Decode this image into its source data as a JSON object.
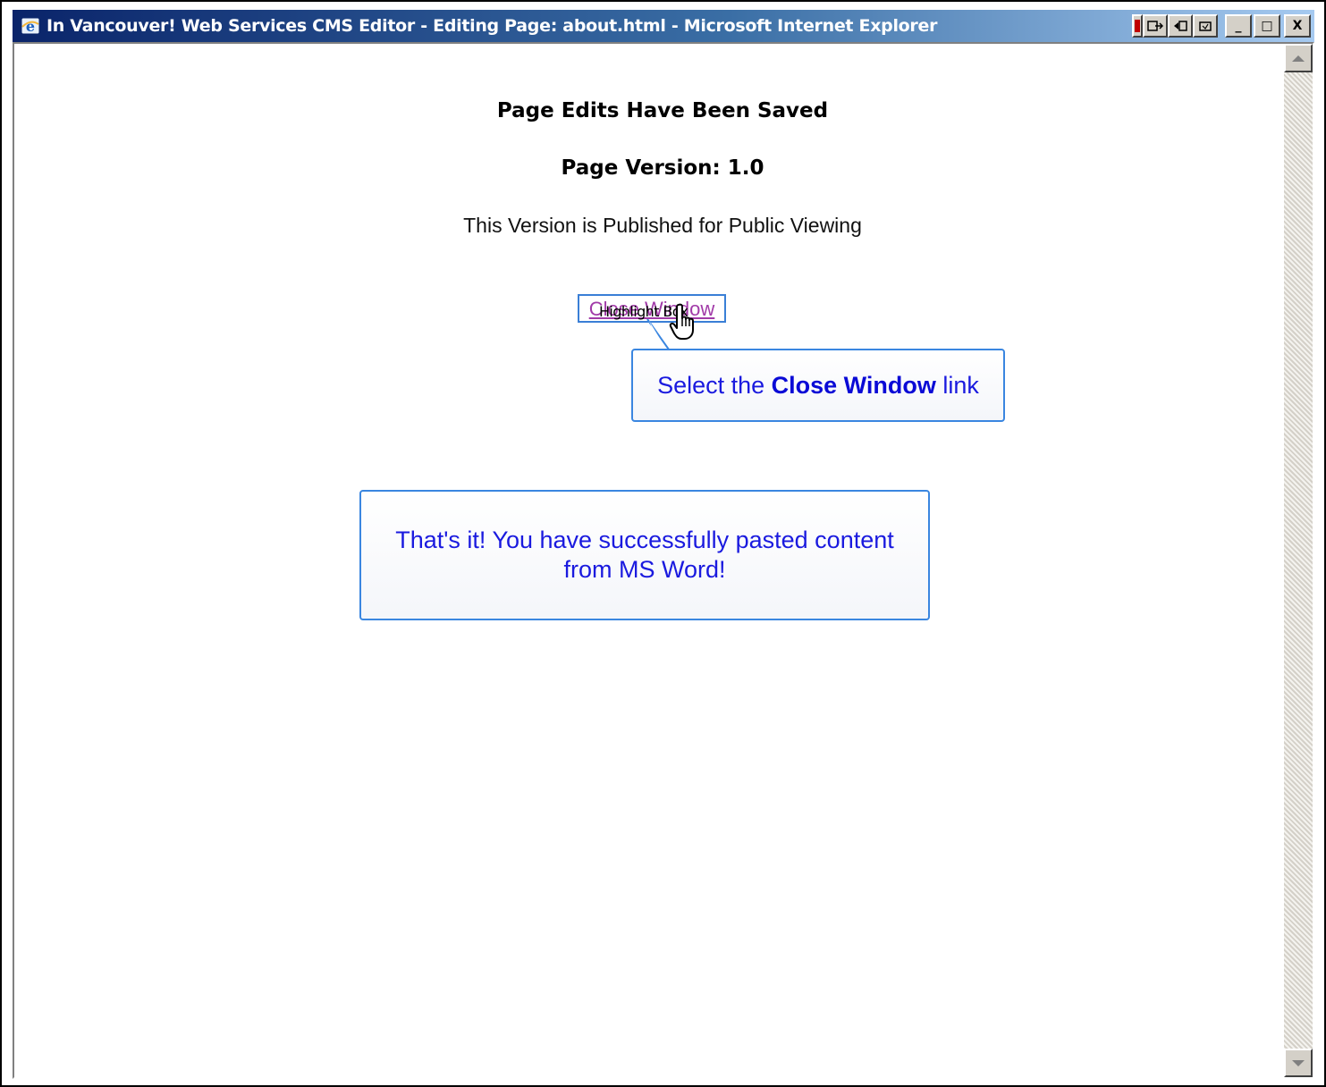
{
  "window": {
    "title": "In Vancouver! Web Services CMS Editor - Editing Page: about.html - Microsoft Internet Explorer",
    "controls": {
      "minimize": "_",
      "maximize": "□",
      "close": "X"
    }
  },
  "page": {
    "saved_heading": "Page Edits Have Been Saved",
    "version_heading": "Page Version: 1.0",
    "published_text": "This Version is Published for Public Viewing",
    "close_link": "Close Window",
    "highlight_label": "Highlight Box"
  },
  "callouts": {
    "select_prefix": "Select the ",
    "select_bold": "Close Window",
    "select_suffix": " link",
    "done_message": "That's it!  You have successfully pasted content from MS Word!"
  },
  "colors": {
    "callout_border": "#3a86e0",
    "callout_text": "#1a1adf",
    "visited_link": "#a13aa8",
    "titlebar_start": "#0a246a",
    "titlebar_end": "#a6caf0"
  },
  "icons": {
    "app_icon": "ie-icon",
    "cursor": "hand-pointer-icon"
  }
}
